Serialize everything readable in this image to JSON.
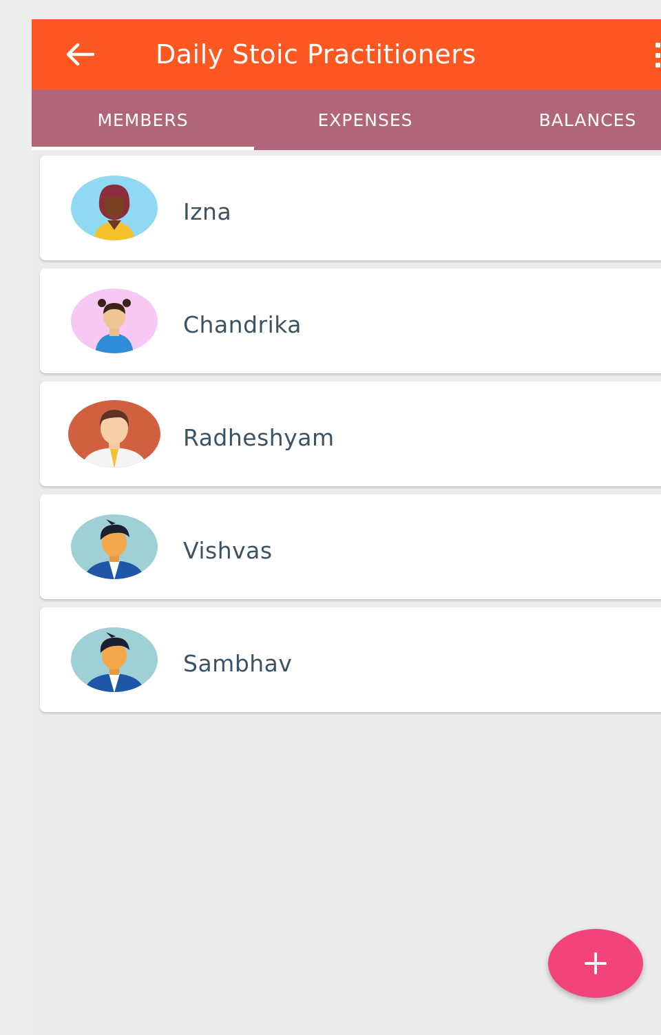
{
  "header": {
    "title": "Daily Stoic Practitioners",
    "back_icon": "arrow-left-icon",
    "menu_icon": "more-vert-icon",
    "color": "#fd5722"
  },
  "tabs": {
    "selected": "MEMBERS",
    "items": [
      {
        "label": "MEMBERS"
      },
      {
        "label": "EXPENSES"
      },
      {
        "label": "BALANCES"
      }
    ],
    "color": "#b06678"
  },
  "members": [
    {
      "name": "Izna",
      "avatar": "woman-avatar-icon"
    },
    {
      "name": "Chandrika",
      "avatar": "girl-avatar-icon"
    },
    {
      "name": "Radheshyam",
      "avatar": "man-avatar-icon"
    },
    {
      "name": "Vishvas",
      "avatar": "boy-avatar-icon"
    },
    {
      "name": "Sambhav",
      "avatar": "boy-avatar-icon"
    }
  ],
  "fab": {
    "icon": "plus-icon",
    "color": "#f3447a"
  }
}
